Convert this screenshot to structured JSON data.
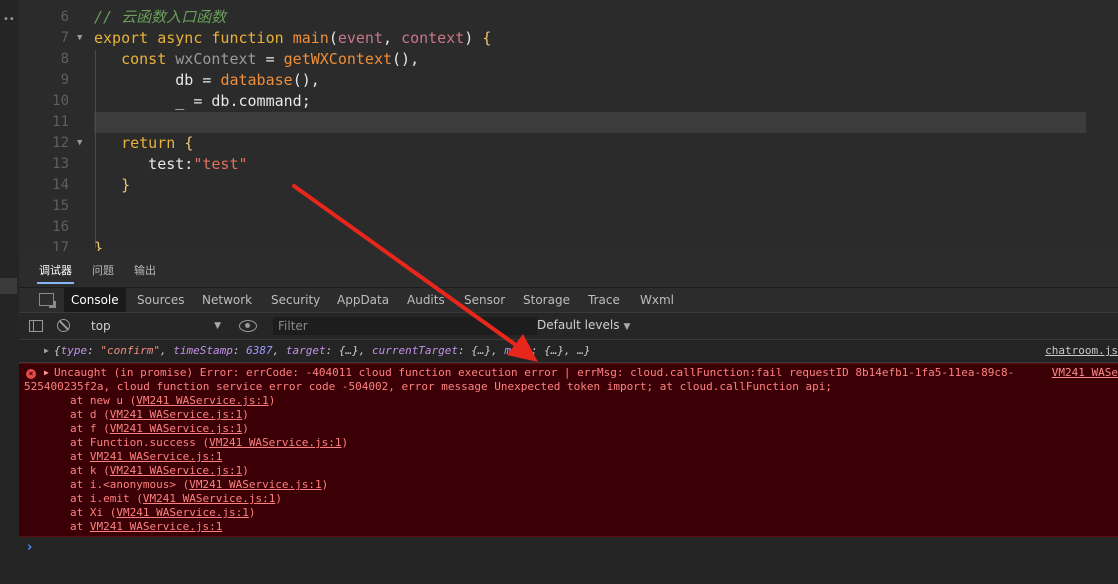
{
  "editor": {
    "lines": [
      {
        "num": "6",
        "fold": false,
        "tokens": [
          {
            "t": "// 云函数入口函数",
            "c": "c"
          }
        ]
      },
      {
        "num": "7",
        "fold": true,
        "tokens": [
          {
            "t": "export ",
            "c": "k"
          },
          {
            "t": "async ",
            "c": "k"
          },
          {
            "t": "function ",
            "c": "k"
          },
          {
            "t": "main",
            "c": "f"
          },
          {
            "t": "(",
            "c": "v"
          },
          {
            "t": "event",
            "c": "p"
          },
          {
            "t": ", ",
            "c": "v"
          },
          {
            "t": "context",
            "c": "p"
          },
          {
            "t": ") ",
            "c": "v"
          },
          {
            "t": "{",
            "c": "b"
          }
        ]
      },
      {
        "num": "8",
        "fold": false,
        "tokens": [
          {
            "t": "   const ",
            "c": "k"
          },
          {
            "t": "wxContext ",
            "c": "dim"
          },
          {
            "t": "= ",
            "c": "v"
          },
          {
            "t": "getWXContext",
            "c": "f"
          },
          {
            "t": "(),",
            "c": "v"
          }
        ]
      },
      {
        "num": "9",
        "fold": false,
        "tokens": [
          {
            "t": "         db ",
            "c": "v"
          },
          {
            "t": "= ",
            "c": "v"
          },
          {
            "t": "database",
            "c": "f"
          },
          {
            "t": "(),",
            "c": "v"
          }
        ]
      },
      {
        "num": "10",
        "fold": false,
        "tokens": [
          {
            "t": "         _ ",
            "c": "v"
          },
          {
            "t": "= ",
            "c": "v"
          },
          {
            "t": "db.command;",
            "c": "v"
          }
        ]
      },
      {
        "num": "11",
        "fold": false,
        "tokens": []
      },
      {
        "num": "12",
        "fold": true,
        "tokens": [
          {
            "t": "   return ",
            "c": "k"
          },
          {
            "t": "{",
            "c": "b"
          }
        ]
      },
      {
        "num": "13",
        "fold": false,
        "tokens": [
          {
            "t": "      test:",
            "c": "v"
          },
          {
            "t": "\"test\"",
            "c": "s"
          }
        ]
      },
      {
        "num": "14",
        "fold": false,
        "tokens": [
          {
            "t": "   }",
            "c": "b"
          }
        ]
      },
      {
        "num": "15",
        "fold": false,
        "tokens": []
      },
      {
        "num": "16",
        "fold": false,
        "tokens": []
      },
      {
        "num": "17",
        "fold": false,
        "tokens": [
          {
            "t": "}",
            "c": "b"
          }
        ]
      }
    ]
  },
  "devtools": {
    "outer_tabs": [
      "调试器",
      "问题",
      "输出"
    ],
    "panel_tabs": [
      "Console",
      "Sources",
      "Network",
      "Security",
      "AppData",
      "Audits",
      "Sensor",
      "Storage",
      "Trace",
      "Wxml"
    ],
    "context_value": "top",
    "filter_placeholder": "Filter",
    "levels_label": "Default levels"
  },
  "console": {
    "object_log": {
      "pieces": [
        {
          "t": "{",
          "c": "i"
        },
        {
          "t": "type",
          "c": "okey"
        },
        {
          "t": ": ",
          "c": "i"
        },
        {
          "t": "\"confirm\"",
          "c": "ostr"
        },
        {
          "t": ", ",
          "c": "i"
        },
        {
          "t": "timeStamp",
          "c": "okey"
        },
        {
          "t": ": ",
          "c": "i"
        },
        {
          "t": "6387",
          "c": "onum"
        },
        {
          "t": ", ",
          "c": "i"
        },
        {
          "t": "target",
          "c": "okey"
        },
        {
          "t": ": {…}, ",
          "c": "i"
        },
        {
          "t": "currentTarget",
          "c": "okey"
        },
        {
          "t": ": {…}, ",
          "c": "i"
        },
        {
          "t": "mark",
          "c": "okey"
        },
        {
          "t": ": {…}, …}",
          "c": "i"
        }
      ],
      "source": "chatroom.js"
    },
    "error": {
      "line1": "Uncaught (in promise) Error: errCode: -404011 cloud function execution error | errMsg: cloud.callFunction:fail requestID 8b14efb1-1fa5-11ea-89c8-",
      "line2": "525400235f2a, cloud function service error code -504002, error message Unexpected token import; at cloud.callFunction api;",
      "source": "VM241 WASe",
      "stack": [
        {
          "pre": "at new u (",
          "link": "VM241 WAService.js:1",
          "post": ")"
        },
        {
          "pre": "at d (",
          "link": "VM241 WAService.js:1",
          "post": ")"
        },
        {
          "pre": "at f (",
          "link": "VM241 WAService.js:1",
          "post": ")"
        },
        {
          "pre": "at Function.success (",
          "link": "VM241 WAService.js:1",
          "post": ")"
        },
        {
          "pre": "at ",
          "link": "VM241 WAService.js:1",
          "post": ""
        },
        {
          "pre": "at k (",
          "link": "VM241 WAService.js:1",
          "post": ")"
        },
        {
          "pre": "at i.<anonymous> (",
          "link": "VM241 WAService.js:1",
          "post": ")"
        },
        {
          "pre": "at i.emit (",
          "link": "VM241 WAService.js:1",
          "post": ")"
        },
        {
          "pre": "at Xi (",
          "link": "VM241 WAService.js:1",
          "post": ")"
        },
        {
          "pre": "at ",
          "link": "VM241 WAService.js:1",
          "post": ""
        }
      ]
    },
    "prompt": "›"
  },
  "colors": {
    "annotation_arrow": "#e8271c",
    "error_bg": "#3b0005",
    "error_text": "#ff8080"
  }
}
